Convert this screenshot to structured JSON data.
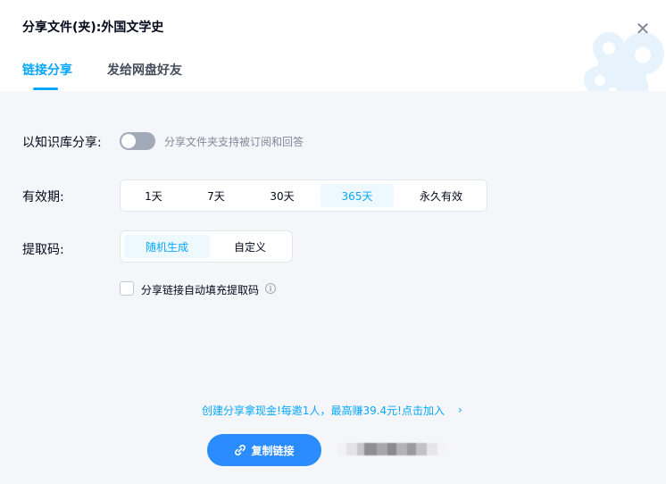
{
  "dialog": {
    "title": "分享文件(夹):外国文学史",
    "close_icon": "close-icon"
  },
  "tabs": [
    {
      "label": "链接分享",
      "active": true
    },
    {
      "label": "发给网盘好友",
      "active": false
    }
  ],
  "knowledge_share": {
    "label": "以知识库分享:",
    "enabled": false,
    "hint": "分享文件夹支持被订阅和回答"
  },
  "validity": {
    "label": "有效期:",
    "options": [
      "1天",
      "7天",
      "30天",
      "365天",
      "永久有效"
    ],
    "selected": "365天"
  },
  "code": {
    "label": "提取码:",
    "options": [
      "随机生成",
      "自定义"
    ],
    "selected": "随机生成"
  },
  "autofill": {
    "label": "分享链接自动填充提取码",
    "checked": false,
    "info_icon": "info-icon"
  },
  "promo": {
    "text": "创建分享拿现金!每邀1人，最高赚39.4元!点击加入",
    "arrow_icon": "chevron-right-icon"
  },
  "copy_button": {
    "label": "复制链接",
    "icon": "link-icon"
  },
  "colors": {
    "accent": "#06a7ff",
    "button": "#2a8cff",
    "background": "#f5f6fa"
  }
}
